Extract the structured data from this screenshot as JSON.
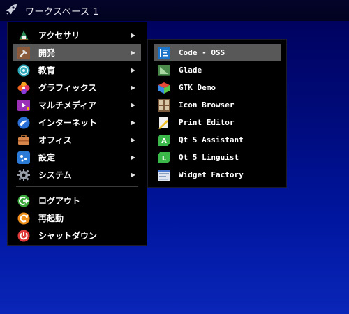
{
  "topbar": {
    "workspace_label": "ワークスペース 1",
    "launcher_icon": "rocket-icon"
  },
  "main_menu": {
    "items": [
      {
        "label": "アクセサリ",
        "icon": "accessories-icon",
        "has_submenu": true
      },
      {
        "label": "開発",
        "icon": "development-icon",
        "has_submenu": true,
        "active": true
      },
      {
        "label": "教育",
        "icon": "education-icon",
        "has_submenu": true
      },
      {
        "label": "グラフィックス",
        "icon": "graphics-icon",
        "has_submenu": true
      },
      {
        "label": "マルチメディア",
        "icon": "multimedia-icon",
        "has_submenu": true
      },
      {
        "label": "インターネット",
        "icon": "internet-icon",
        "has_submenu": true
      },
      {
        "label": "オフィス",
        "icon": "office-icon",
        "has_submenu": true
      },
      {
        "label": "設定",
        "icon": "settings-icon",
        "has_submenu": true
      },
      {
        "label": "システム",
        "icon": "system-icon",
        "has_submenu": true
      }
    ],
    "session_items": [
      {
        "label": "ログアウト",
        "icon": "logout-icon"
      },
      {
        "label": "再起動",
        "icon": "reboot-icon"
      },
      {
        "label": "シャットダウン",
        "icon": "shutdown-icon"
      }
    ]
  },
  "submenu": {
    "items": [
      {
        "label": "Code - OSS",
        "icon": "code-oss-icon",
        "active": true
      },
      {
        "label": "Glade",
        "icon": "glade-icon"
      },
      {
        "label": "GTK Demo",
        "icon": "gtk-demo-icon"
      },
      {
        "label": "Icon Browser",
        "icon": "icon-browser-icon"
      },
      {
        "label": "Print Editor",
        "icon": "print-editor-icon"
      },
      {
        "label": "Qt 5 Assistant",
        "icon": "qt-assistant-icon"
      },
      {
        "label": "Qt 5 Linguist",
        "icon": "qt-linguist-icon"
      },
      {
        "label": "Widget Factory",
        "icon": "widget-factory-icon"
      }
    ]
  },
  "colors": {
    "highlight": "#585858",
    "menu_bg": "#000000",
    "desktop_top": "#00005a",
    "desktop_bottom": "#0a26b8"
  }
}
